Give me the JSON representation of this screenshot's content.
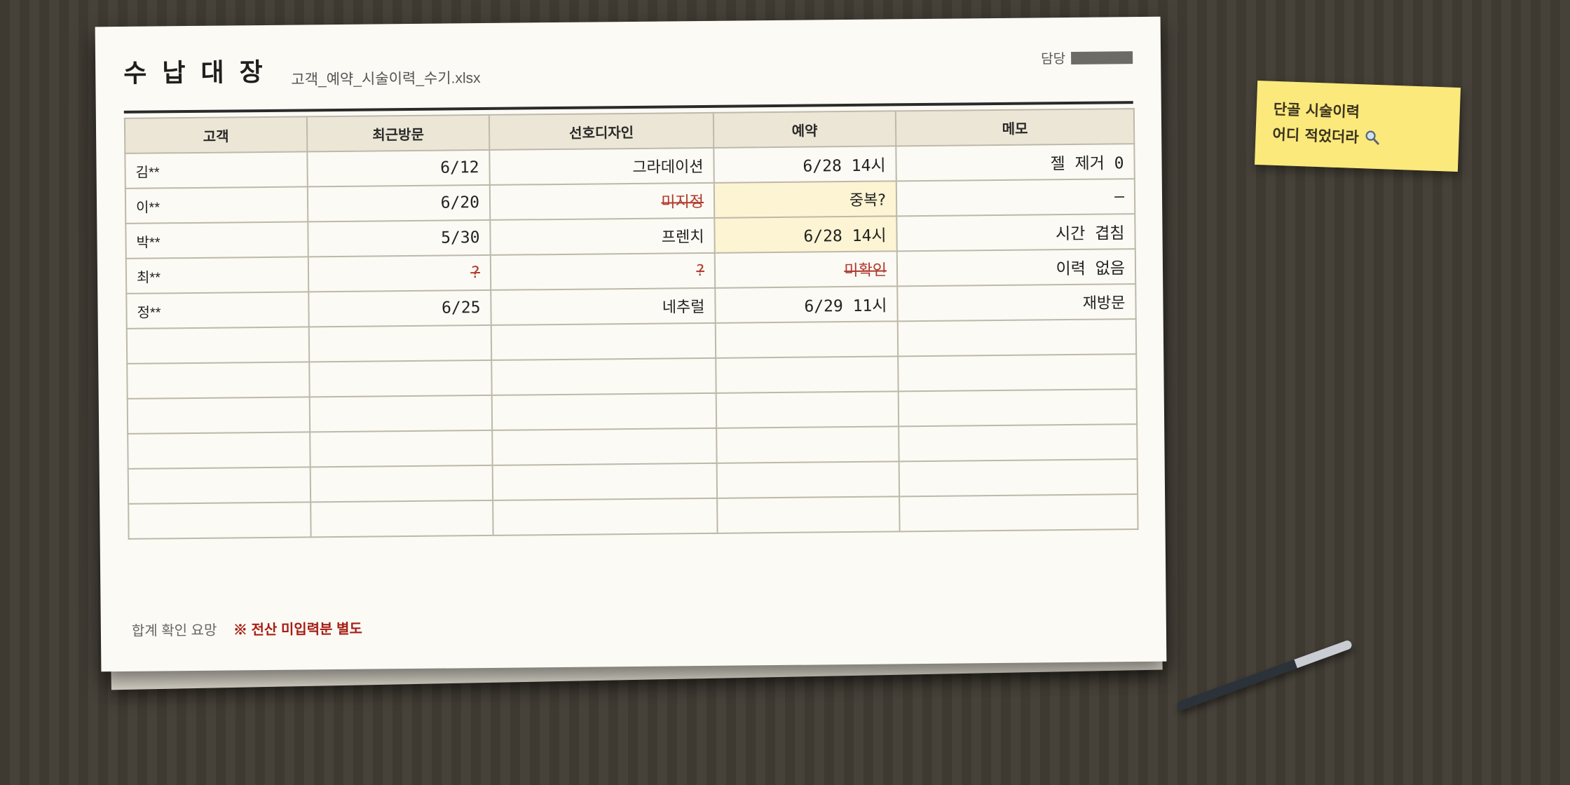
{
  "ledger": {
    "title": "수납대장",
    "filename": "고객_예약_시술이력_수기.xlsx",
    "assignee_label": "담당",
    "columns": [
      "고객",
      "최근방문",
      "선호디자인",
      "예약",
      "메모"
    ],
    "rows": [
      {
        "customer": "김**",
        "last_visit": "6/12",
        "design": "그라데이션",
        "reservation": "6/28 14시",
        "memo": "젤 제거 0"
      },
      {
        "customer": "이**",
        "last_visit": "6/20",
        "design": "미지정",
        "reservation": "중복?",
        "memo": "–"
      },
      {
        "customer": "박**",
        "last_visit": "5/30",
        "design": "프렌치",
        "reservation": "6/28 14시",
        "memo": "시간 겹침"
      },
      {
        "customer": "최**",
        "last_visit": "?",
        "design": "?",
        "reservation": "미확인",
        "memo": "이력 없음"
      },
      {
        "customer": "정**",
        "last_visit": "6/25",
        "design": "네추럴",
        "reservation": "6/29 11시",
        "memo": "재방문"
      }
    ],
    "empty_row_count": 6,
    "footer": {
      "total_check": "합계 확인 요망",
      "note": "※ 전산 미입력분 별도"
    }
  },
  "sticky_note": {
    "line1": "단골 시술이력",
    "line2": "어디 적었더라",
    "icon": "magnifier-icon"
  },
  "colors": {
    "desk": "#433e36",
    "paper": "#fcfaf4",
    "header_cell": "#ece6d6",
    "highlight": "#fcf4d3",
    "strike_red": "#b03a2e",
    "note_red": "#a51f16",
    "sticky": "#fbe97b"
  }
}
